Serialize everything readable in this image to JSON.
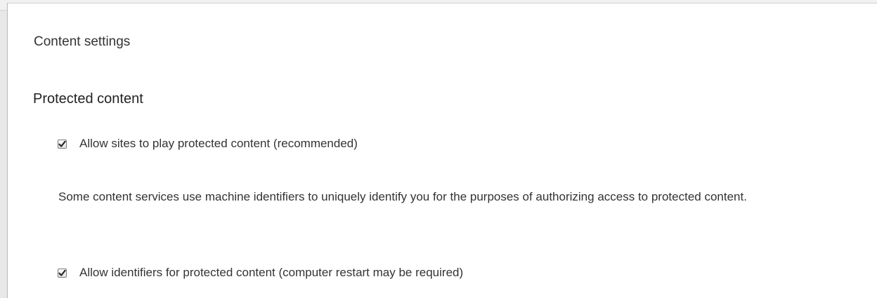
{
  "dialog": {
    "title": "Content settings"
  },
  "section": {
    "title": "Protected content",
    "options": [
      {
        "label": "Allow sites to play protected content (recommended)",
        "checked": true
      },
      {
        "label": "Allow identifiers for protected content (computer restart may be required)",
        "checked": true
      }
    ],
    "description": "Some content services use machine identifiers to uniquely identify you for the purposes of authorizing access to protected content."
  },
  "icons": {
    "checkmark": "check-icon"
  }
}
